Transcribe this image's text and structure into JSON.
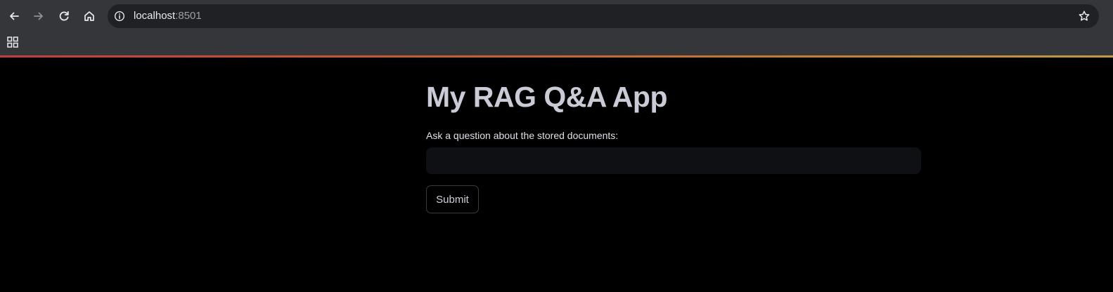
{
  "browser": {
    "address_bar": {
      "host": "localhost",
      "port": ":8501"
    },
    "icons": {
      "back": "arrow-left-icon",
      "forward": "arrow-right-icon",
      "reload": "reload-icon",
      "home": "home-icon",
      "site_info": "info-icon",
      "bookmark": "star-icon",
      "apps": "apps-grid-icon"
    },
    "colors": {
      "chrome_bg": "#35363a",
      "omnibox_bg": "#202124",
      "accent_gradient": [
        "#ff4b4b",
        "#ff8a3d",
        "#fdc75b"
      ]
    }
  },
  "app": {
    "title": "My RAG Q&A App",
    "question": {
      "label": "Ask a question about the stored documents:",
      "value": ""
    },
    "submit_label": "Submit",
    "colors": {
      "background": "#000000",
      "title": "#c9cbd6",
      "input_bg": "#0f1014"
    }
  }
}
